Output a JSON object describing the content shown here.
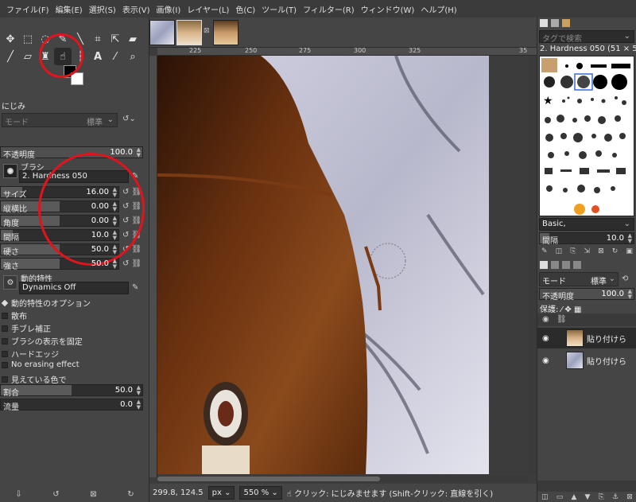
{
  "menubar": {
    "items": [
      "ファイル(F)",
      "編集(E)",
      "選択(S)",
      "表示(V)",
      "画像(I)",
      "レイヤー(L)",
      "色(C)",
      "ツール(T)",
      "フィルター(R)",
      "ウィンドウ(W)",
      "ヘルプ(H)"
    ]
  },
  "tool_options": {
    "title": "にじみ",
    "mode_label": "モード",
    "mode_value": "標準",
    "opacity": {
      "label": "不透明度",
      "value": "100.0",
      "fraction": 1.0
    },
    "brush": {
      "label": "ブラシ",
      "name": "2. Hardness 050"
    },
    "size": {
      "label": "サイズ",
      "value": "16.00",
      "fraction": 0.18
    },
    "aspect": {
      "label": "縦横比",
      "value": "0.00",
      "fraction": 0.5
    },
    "angle": {
      "label": "角度",
      "value": "0.00",
      "fraction": 0.5
    },
    "spacing": {
      "label": "間隔",
      "value": "10.0",
      "fraction": 0.1
    },
    "hardness": {
      "label": "硬さ",
      "value": "50.0",
      "fraction": 0.5
    },
    "force": {
      "label": "強さ",
      "value": "50.0",
      "fraction": 0.5
    },
    "dynamics": {
      "label": "動的特性",
      "name": "Dynamics Off"
    },
    "dynamics_options": "動的特性のオプション",
    "checkboxes": [
      "散布",
      "手ブレ補正",
      "ブラシの表示を固定",
      "ハードエッジ",
      "No erasing effect",
      "見えている色で"
    ],
    "rate": {
      "label": "割合",
      "value": "50.0",
      "fraction": 0.5
    },
    "flow": {
      "label": "流量",
      "value": "0.0",
      "fraction": 0.0
    }
  },
  "ruler": {
    "ticks": [
      "225",
      "250",
      "275",
      "300",
      "325",
      "35"
    ]
  },
  "status": {
    "coords": "299.8, 124.5",
    "unit": "px",
    "zoom": "550 %",
    "message": "クリック: にじみませます (Shift-クリック: 直線を引く)"
  },
  "brushes_panel": {
    "search_placeholder": "タグで検索",
    "selected": "2. Hardness 050 (51 × 51)",
    "preset": "Basic,",
    "spacing": {
      "label": "間隔",
      "value": "10.0"
    }
  },
  "layers_panel": {
    "mode_label": "モード",
    "mode_value": "標準",
    "opacity": {
      "label": "不透明度",
      "value": "100.0"
    },
    "lock_label": "保護:",
    "layers": [
      {
        "name": "貼り付けら",
        "selected": true
      },
      {
        "name": "貼り付けら",
        "selected": false
      }
    ]
  },
  "colors": {
    "annotation": "#e0141c",
    "background": "#454545"
  },
  "icons": [
    "move-icon",
    "rect-select-icon",
    "lasso-icon",
    "path-icon",
    "crop-icon",
    "transform-icon",
    "paintbrush-icon",
    "eraser-icon",
    "clone-icon",
    "smudge-icon",
    "text-icon",
    "color-picker-icon",
    "zoom-icon"
  ]
}
